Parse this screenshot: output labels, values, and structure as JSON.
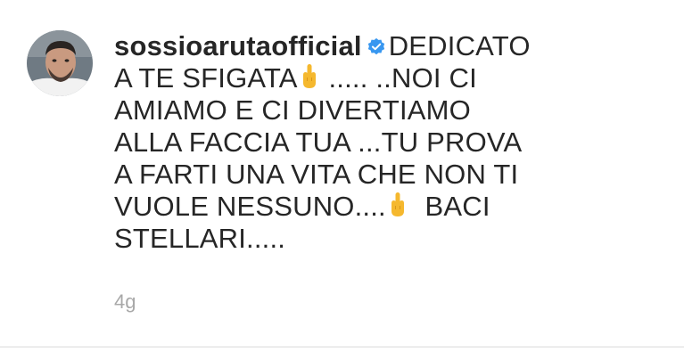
{
  "comment": {
    "username": "sossioarutaofficial",
    "verified": true,
    "lines": [
      "DEDICATO",
      "A TE SFIGATA",
      " ..... ..NOI CI",
      "AMIAMO E CI DIVERTIAMO",
      "ALLA FACCIA TUA ...TU PROVA",
      "A FARTI UNA VITA CHE NON TI",
      "VUOLE NESSUNO....",
      "  BACI",
      "STELLARI....."
    ],
    "emoji": "middle-finger-icon",
    "timestamp": "4g"
  },
  "colors": {
    "text": "#262626",
    "verified": "#3897f0",
    "meta": "#a8a8a8",
    "divider": "#dbdbdb"
  }
}
